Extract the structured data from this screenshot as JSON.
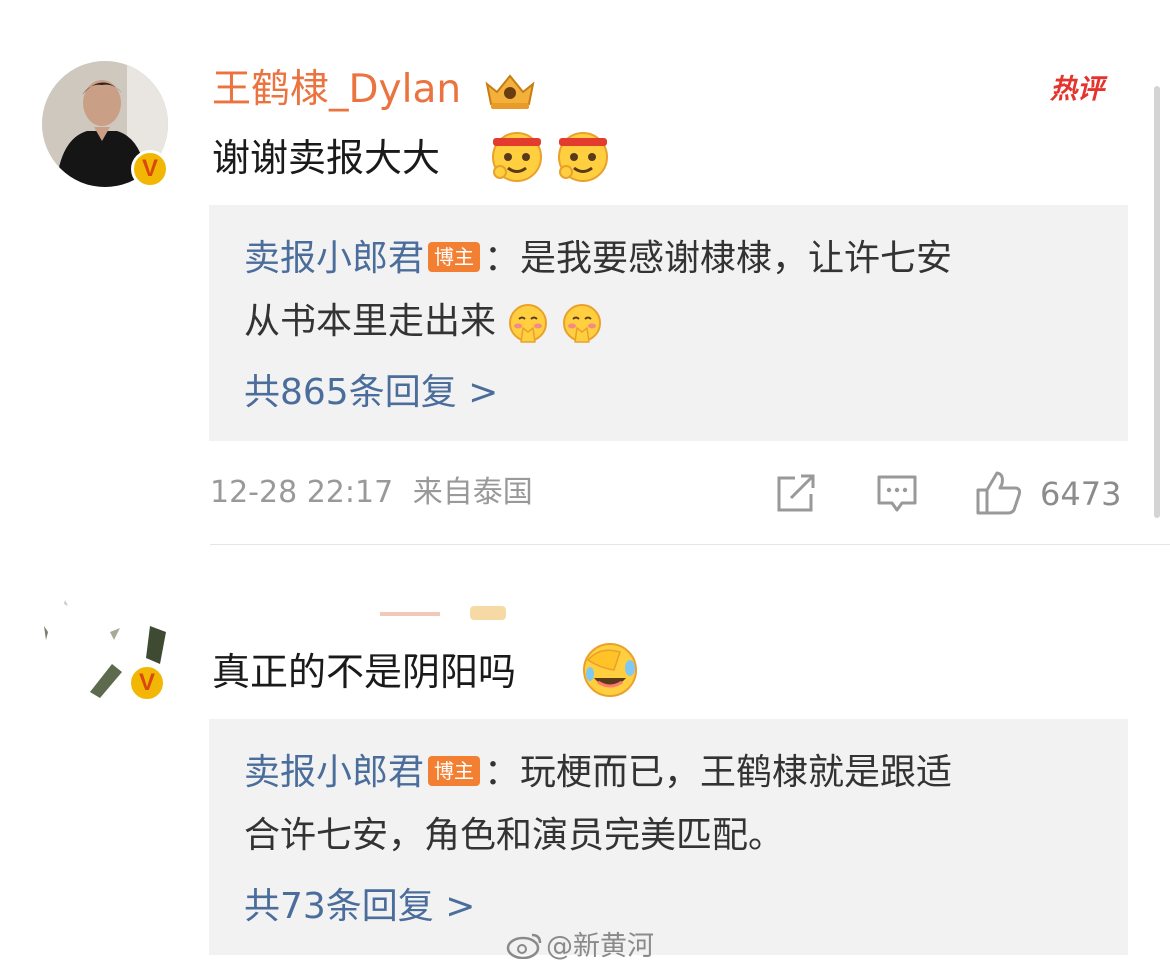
{
  "comments": [
    {
      "username": "王鹤棣_Dylan",
      "hot_label": "热评",
      "text": "谢谢卖报大大",
      "reply": {
        "author": "卖报小郎君",
        "author_tag": "博主",
        "separator": "：",
        "line1": "是我要感谢棣棣，让许七安",
        "line2": "从书本里走出来",
        "count_text": "共865条回复 >"
      },
      "meta": {
        "time": "12-28 22:17",
        "source": "来自泰国",
        "like_count": "6473"
      }
    },
    {
      "text": "真正的不是阴阳吗",
      "reply": {
        "author": "卖报小郎君",
        "author_tag": "博主",
        "separator": "：",
        "line1": "玩梗而已，王鹤棣就是跟适",
        "line2": "合许七安，角色和演员完美匹配。",
        "count_text": "共73条回复 >"
      }
    }
  ],
  "watermark": "@新黄河",
  "colors": {
    "username": "#eb7340",
    "reply_author": "#4a6d9c",
    "host_tag": "#f37f33",
    "hot_label": "#e5342e"
  }
}
